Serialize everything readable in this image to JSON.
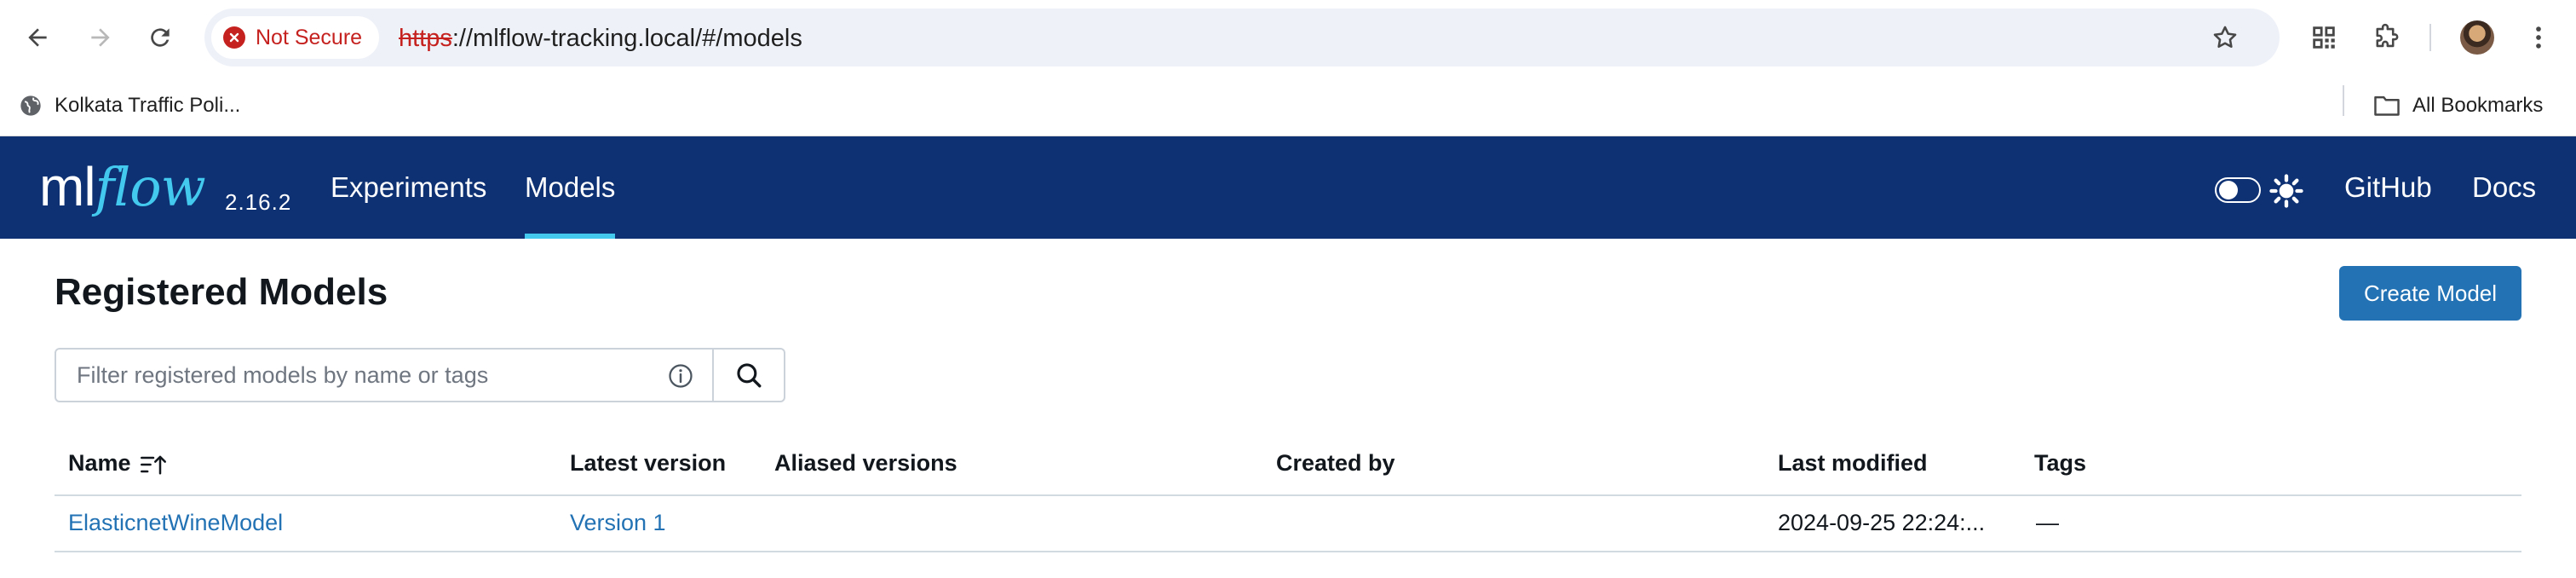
{
  "browser": {
    "security_label": "Not Secure",
    "url_scheme": "https",
    "url_rest": "://mlflow-tracking.local/#/models",
    "bookmarks": [
      {
        "label": "Kolkata Traffic Poli..."
      }
    ],
    "all_bookmarks_label": "All Bookmarks"
  },
  "header": {
    "logo_ml": "ml",
    "logo_flow": "flow",
    "version": "2.16.2",
    "nav": [
      {
        "label": "Experiments",
        "active": false
      },
      {
        "label": "Models",
        "active": true
      }
    ],
    "links": [
      {
        "label": "GitHub"
      },
      {
        "label": "Docs"
      }
    ],
    "accent_color": "#43c9ed",
    "background_color": "#0e3174"
  },
  "main": {
    "title": "Registered Models",
    "create_button": "Create Model",
    "search": {
      "placeholder": "Filter registered models by name or tags",
      "value": ""
    },
    "table": {
      "columns": [
        "Name",
        "Latest version",
        "Aliased versions",
        "Created by",
        "Last modified",
        "Tags"
      ],
      "rows": [
        {
          "name": "ElasticnetWineModel",
          "latest_version": "Version 1",
          "aliased_versions": "",
          "created_by": "",
          "last_modified": "2024-09-25 22:24:...",
          "tags": "—"
        }
      ]
    }
  }
}
